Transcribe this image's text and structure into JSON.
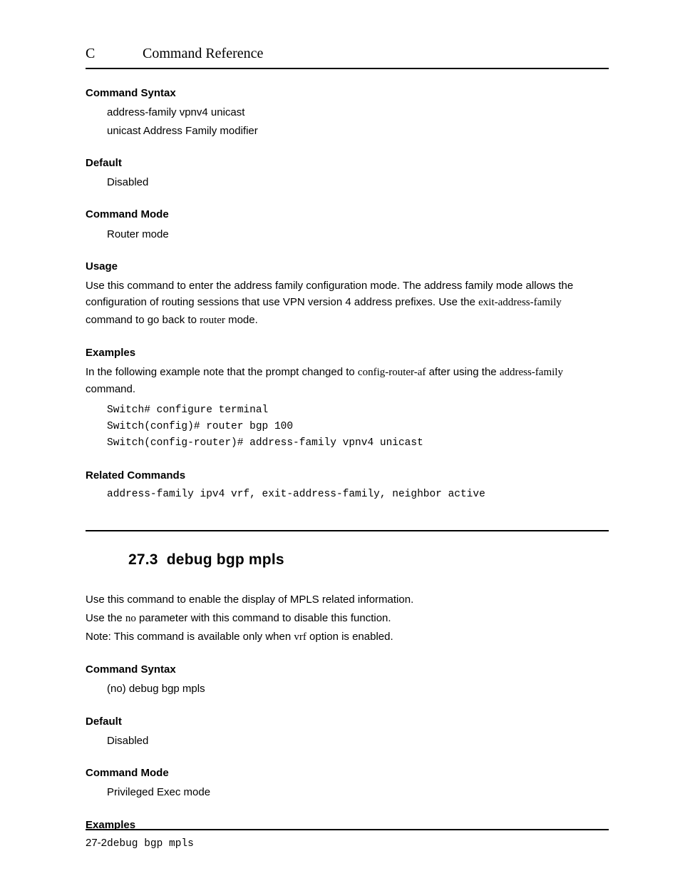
{
  "header": {
    "letter": "C",
    "title": "Command Reference"
  },
  "sec1": {
    "syntax_h": "Command Syntax",
    "syntax_l1": "address-family vpnv4 unicast",
    "syntax_l2": "unicast Address Family modifier",
    "default_h": "Default",
    "default_v": "Disabled",
    "mode_h": "Command Mode",
    "mode_v": "Router mode",
    "usage_h": "Usage",
    "usage_p1a": "Use this command to enter the address family configuration mode. The address family mode allows the configuration of routing sessions that use VPN version 4 address prefixes. Use the ",
    "usage_cmd1": "exit-address-family",
    "usage_p1b": " command to go back to ",
    "usage_cmd2": "router",
    "usage_p1c": " mode.",
    "examples_h": "Examples",
    "examples_p_a": "In the following example note that the prompt changed to ",
    "examples_kw1": "config-router-af",
    "examples_p_b": " after using the ",
    "examples_kw2": "address-family",
    "examples_p_c": " command.",
    "code_l1": "Switch# configure terminal",
    "code_l2": "Switch(config)# router bgp 100",
    "code_l3": "Switch(config-router)# address-family vpnv4 unicast",
    "related_h": "Related Commands",
    "related_v": "address-family ipv4 vrf, exit-address-family, neighbor active"
  },
  "sec2": {
    "number": "27.3",
    "title": "debug bgp mpls",
    "intro_l1": "Use this command to enable the display of MPLS related information.",
    "intro_l2a": "Use the ",
    "intro_no": "no",
    "intro_l2b": " parameter with this command to disable this function.",
    "intro_l3a": "Note: This command is available only when ",
    "intro_vrf": "vrf",
    "intro_l3b": " option is enabled.",
    "syntax_h": "Command Syntax",
    "syntax_v": "(no) debug bgp mpls",
    "default_h": "Default",
    "default_v": "Disabled",
    "mode_h": "Command Mode",
    "mode_v": "Privileged Exec mode",
    "examples_h": "Examples",
    "examples_v": "debug bgp mpls"
  },
  "footer": {
    "page": "27-2"
  }
}
